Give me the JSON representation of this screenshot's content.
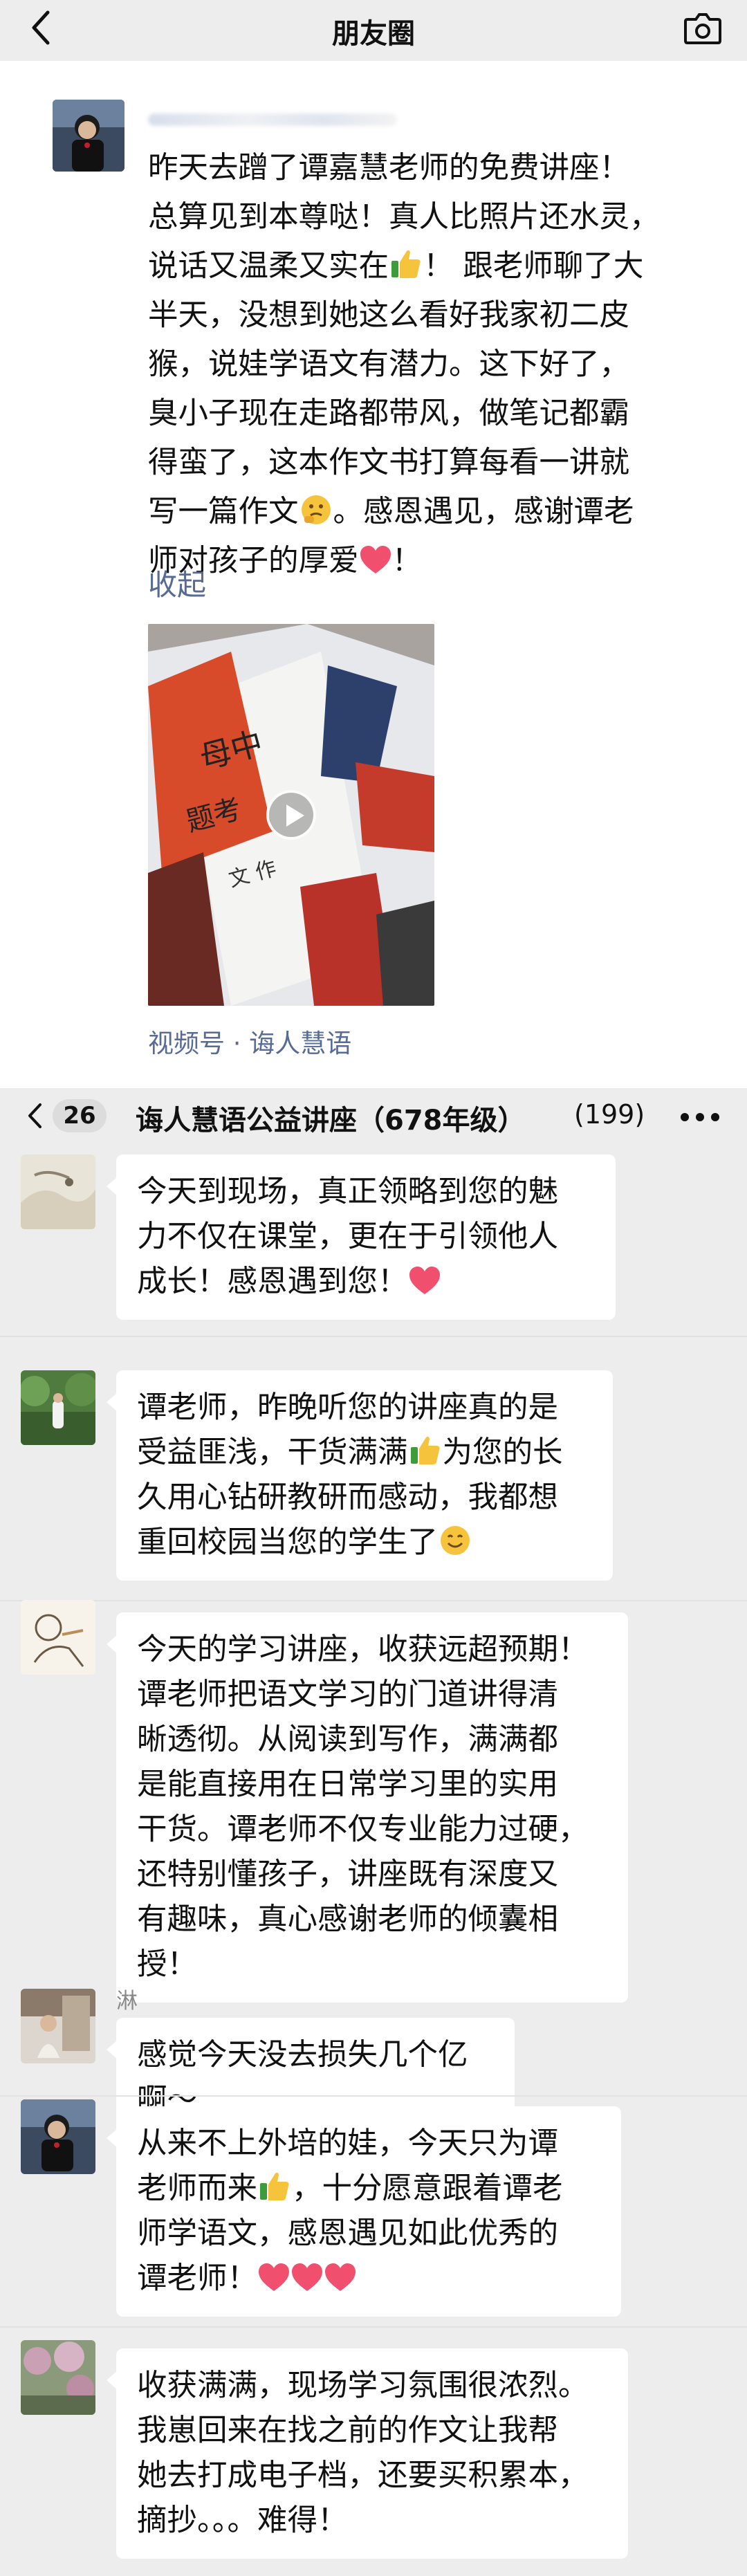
{
  "moments": {
    "header_title": "朋友圈",
    "post_text_lines": [
      "昨天去蹭了谭嘉慧老师的免费讲座！",
      "总算见到本尊哒！真人比照片还水灵，",
      "说话又温柔又实在",
      "！ 跟老师聊了大",
      "半天，没想到她这么看好我家初二皮",
      "猴，说娃学语文有潜力。这下好了，",
      "臭小子现在走路都带风，做笔记都霸",
      "得蛮了，这本作文书打算每看一讲就",
      "写一篇作文",
      "。感恩遇见，感谢谭老",
      "师对孩子的厚爱",
      "！"
    ],
    "collapse_label": "收起",
    "video_source": "视频号 · 诲人慧语"
  },
  "chat": {
    "back_count": "26",
    "group_title": "诲人慧语公益讲座（678年级）",
    "member_count": "(199)",
    "messages": [
      {
        "sender": "",
        "text": "今天到现场，真正领略到您的魅\n力不仅在课堂，更在于引领他人\n成长！感恩遇到您！"
      },
      {
        "sender": "",
        "text_a": "谭老师，昨晚听您的讲座真的是\n受益匪浅，干货满满",
        "text_b": "为您的长\n久用心钻研教研而感动，我都想\n重回校园当您的学生了"
      },
      {
        "sender": "",
        "text": "今天的学习讲座，收获远超预期！\n谭老师把语文学习的门道讲得清\n晰透彻。从阅读到写作，满满都\n是能直接用在日常学习里的实用\n干货。谭老师不仅专业能力过硬，\n还特别懂孩子，讲座既有深度又\n有趣味，真心感谢老师的倾囊相\n授！"
      },
      {
        "sender": "淋",
        "text": "感觉今天没去损失几个亿啊～"
      },
      {
        "sender": "",
        "text_a": "从来不上外培的娃，今天只为谭\n老师而来",
        "text_b": "，十分愿意跟着谭老\n师学语文，感恩遇见如此优秀的\n谭老师！"
      },
      {
        "sender": "",
        "text": "收获满满，现场学习氛围很浓烈。\n我崽回来在找之前的作文让我帮\n她去打成电子档，还要买积累本，\n摘抄。。。难得！"
      }
    ]
  },
  "colors": {
    "link": "#576b95",
    "heart": "#f0506e",
    "bubble": "#ffffff",
    "chat_bg": "#ededed"
  },
  "icons": [
    "back-arrow-icon",
    "camera-icon",
    "play-icon",
    "more-icon",
    "heart-emoji-icon",
    "thumbs-up-emoji-icon",
    "smile-emoji-icon"
  ]
}
